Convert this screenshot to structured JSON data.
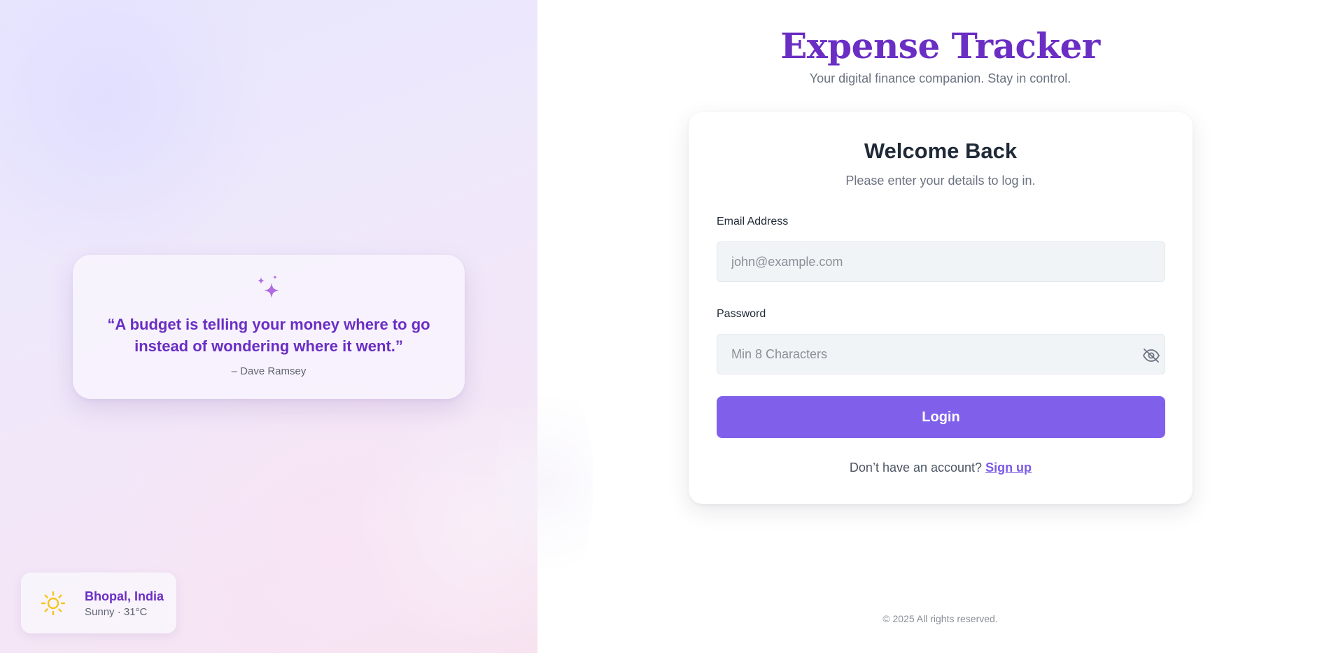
{
  "quote": {
    "text": "“A budget is telling your money where to go instead of wondering where it went.”",
    "author": "– Dave Ramsey",
    "icon": "sparkle-icon"
  },
  "weather": {
    "city": "Bhopal, India",
    "condition": "Sunny · 31°C",
    "icon": "sun-icon"
  },
  "brand": {
    "title": "Expense Tracker",
    "tagline": "Your digital finance companion. Stay in control."
  },
  "login": {
    "heading": "Welcome Back",
    "subheading": "Please enter your details to log in.",
    "email_label": "Email Address",
    "email_placeholder": "john@example.com",
    "email_value": "",
    "password_label": "Password",
    "password_placeholder": "Min 8 Characters",
    "password_value": "",
    "password_toggle_icon": "eye-off-icon",
    "button_label": "Login",
    "signup_prompt": "Don’t have an account?",
    "signup_link": "Sign up"
  },
  "footer": {
    "text": "© 2025 All rights reserved."
  },
  "colors": {
    "accent": "#6a2ec4",
    "button": "#8060eb",
    "link": "#7c5ae6",
    "sun": "#f5c518",
    "sparkle": "#b06be0"
  }
}
